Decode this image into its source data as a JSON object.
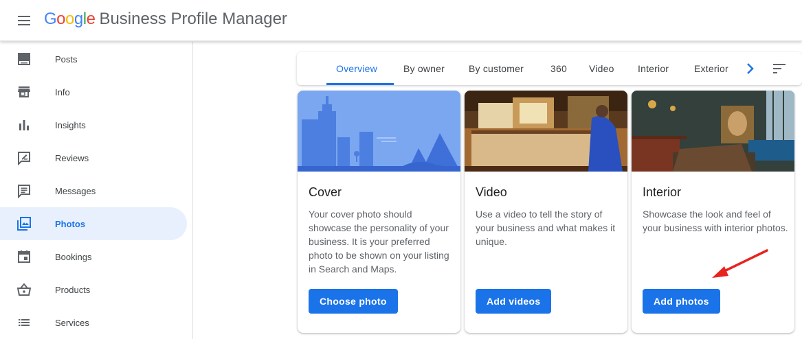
{
  "header": {
    "logo_letters": [
      "G",
      "o",
      "o",
      "g",
      "l",
      "e"
    ],
    "product_name": "Business Profile Manager"
  },
  "sidebar": {
    "items": [
      {
        "label": "Posts",
        "icon": "posts-icon"
      },
      {
        "label": "Info",
        "icon": "store-icon"
      },
      {
        "label": "Insights",
        "icon": "bar-chart-icon"
      },
      {
        "label": "Reviews",
        "icon": "review-icon"
      },
      {
        "label": "Messages",
        "icon": "message-icon"
      },
      {
        "label": "Photos",
        "icon": "photo-library-icon",
        "active": true
      },
      {
        "label": "Bookings",
        "icon": "calendar-icon"
      },
      {
        "label": "Products",
        "icon": "basket-icon"
      },
      {
        "label": "Services",
        "icon": "list-icon"
      }
    ]
  },
  "tabs": {
    "items": [
      "Overview",
      "By owner",
      "By customer",
      "360",
      "Video",
      "Interior",
      "Exterior"
    ],
    "active": "Overview"
  },
  "cards": [
    {
      "title": "Cover",
      "description": "Your cover photo should showcase the personality of your business. It is your preferred photo to be shown on your listing in Search and Maps.",
      "button": "Choose photo"
    },
    {
      "title": "Video",
      "description": "Use a video to tell the story of your business and what makes it unique.",
      "button": "Add videos"
    },
    {
      "title": "Interior",
      "description": "Showcase the look and feel of your business with interior photos.",
      "button": "Add photos"
    }
  ],
  "colors": {
    "accent": "#1a73e8",
    "active_nav_bg": "#e8f0fe",
    "annotation_arrow": "#e8231e"
  }
}
